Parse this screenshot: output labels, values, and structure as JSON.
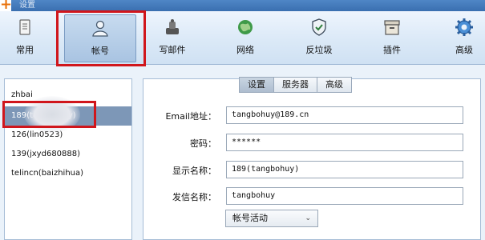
{
  "window": {
    "title": "设置",
    "accent": "#3a6fb0"
  },
  "toolbar": {
    "items": [
      {
        "label": "常用",
        "icon": "document-icon"
      },
      {
        "label": "帐号",
        "icon": "user-icon"
      },
      {
        "label": "写邮件",
        "icon": "compose-icon"
      },
      {
        "label": "网络",
        "icon": "globe-icon"
      },
      {
        "label": "反垃圾",
        "icon": "shield-icon"
      },
      {
        "label": "插件",
        "icon": "box-icon"
      },
      {
        "label": "高级",
        "icon": "gear-icon"
      }
    ],
    "active_index": 1
  },
  "accounts": [
    {
      "label": "zhbai"
    },
    {
      "label": "189(tangbohuy)"
    },
    {
      "label": "126(lin0523)"
    },
    {
      "label": "139(jxyd680888)"
    },
    {
      "label": "telincn(baizhihua)"
    }
  ],
  "tabs": [
    {
      "label": "设置",
      "active": true
    },
    {
      "label": "服务器",
      "active": false
    },
    {
      "label": "高级",
      "active": false
    }
  ],
  "form": {
    "email_label": "Email地址：",
    "email_value": "tangbohuy@189.cn",
    "password_label": "密码：",
    "password_value": "******",
    "display_label": "显示名称：",
    "display_value": "189(tangbohuy)",
    "sender_label": "发信名称：",
    "sender_value": "tangbohuy",
    "status_value": "帐号活动"
  },
  "highlight_color": "#d0161c"
}
